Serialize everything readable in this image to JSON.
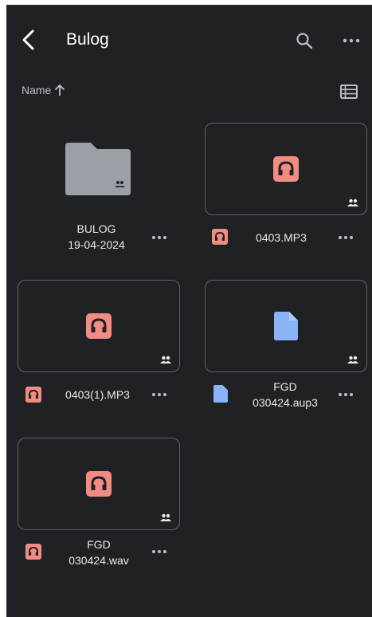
{
  "header": {
    "title": "Bulog"
  },
  "sort": {
    "label": "Name"
  },
  "colors": {
    "audio": "#f28b82",
    "doc": "#8ab4f8",
    "folder": "#9aa0a6",
    "bg": "#202124"
  },
  "items": [
    {
      "type": "folder",
      "name_line1": "BULOG",
      "name_line2": "19-04-2024",
      "icon": "folder-shared-icon"
    },
    {
      "type": "audio",
      "name_line1": "0403.MP3",
      "icon": "headphones-icon"
    },
    {
      "type": "audio",
      "name_line1": "0403(1).MP3",
      "icon": "headphones-icon"
    },
    {
      "type": "document",
      "name_line1": "FGD",
      "name_line2": "030424.aup3",
      "icon": "file-icon"
    },
    {
      "type": "audio",
      "name_line1": "FGD",
      "name_line2": "030424.wav",
      "icon": "headphones-icon"
    }
  ]
}
